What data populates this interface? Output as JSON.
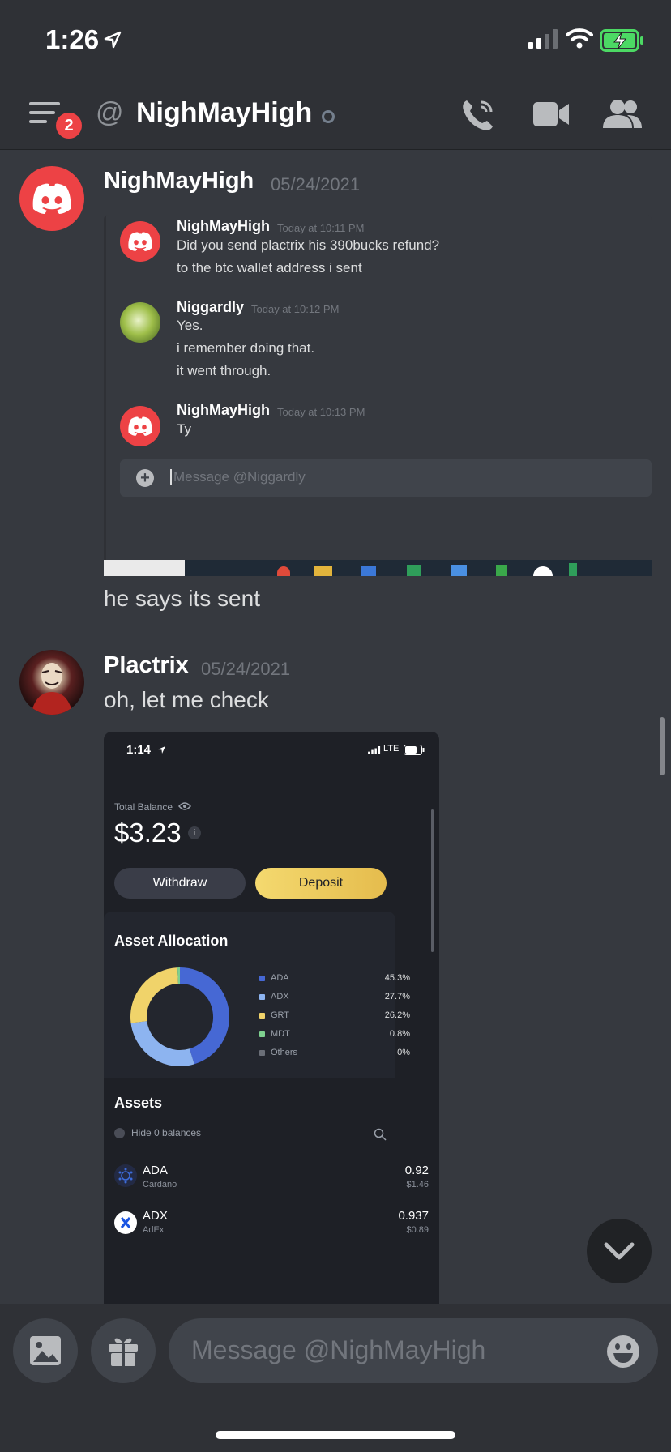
{
  "status_bar": {
    "time": "1:26"
  },
  "header": {
    "unread_badge": "2",
    "at_symbol": "@",
    "title": "NighMayHigh"
  },
  "messages": [
    {
      "author": "NighMayHigh",
      "timestamp": "05/24/2021",
      "text": "he says its sent"
    },
    {
      "author": "Plactrix",
      "timestamp": "05/24/2021",
      "text": "oh, let me check"
    }
  ],
  "screenshot1": {
    "messages": [
      {
        "author": "NighMayHigh",
        "time": "Today at 10:11 PM",
        "lines": [
          "Did you send plactrix his 390bucks refund?",
          "to the btc wallet address i sent"
        ]
      },
      {
        "author": "Niggardly",
        "time": "Today at 10:12 PM",
        "lines": [
          "Yes.",
          "i remember doing that.",
          "it went through."
        ]
      },
      {
        "author": "NighMayHigh",
        "time": "Today at 10:13 PM",
        "lines": [
          "Ty"
        ]
      }
    ],
    "input_placeholder": "Message @Niggardly"
  },
  "screenshot2": {
    "time": "1:14",
    "network": "LTE",
    "total_balance_label": "Total Balance",
    "total_balance": "$3.23",
    "withdraw_label": "Withdraw",
    "deposit_label": "Deposit",
    "allocation_title": "Asset Allocation",
    "allocation": [
      {
        "name": "ADA",
        "pct": "45.3%",
        "value": 45.3,
        "color": "#4668d4"
      },
      {
        "name": "ADX",
        "pct": "27.7%",
        "value": 27.7,
        "color": "#8db4f0"
      },
      {
        "name": "GRT",
        "pct": "26.2%",
        "value": 26.2,
        "color": "#f0d36a"
      },
      {
        "name": "MDT",
        "pct": "0.8%",
        "value": 0.8,
        "color": "#7ed08f"
      },
      {
        "name": "Others",
        "pct": "0%",
        "value": 0,
        "color": "#6b6f78"
      }
    ],
    "assets_title": "Assets",
    "hide_label": "Hide 0 balances",
    "assets": [
      {
        "symbol": "ADA",
        "name": "Cardano",
        "amount": "0.92",
        "usd": "$1.46"
      },
      {
        "symbol": "ADX",
        "name": "AdEx",
        "amount": "0.937",
        "usd": "$0.89"
      }
    ]
  },
  "composer": {
    "placeholder": "Message @NighMayHigh"
  },
  "colors": {
    "background": "#36393f",
    "header": "#2f3136",
    "badge": "#ed4245",
    "deposit": "#f0d36a",
    "battery": "#4cd964"
  }
}
